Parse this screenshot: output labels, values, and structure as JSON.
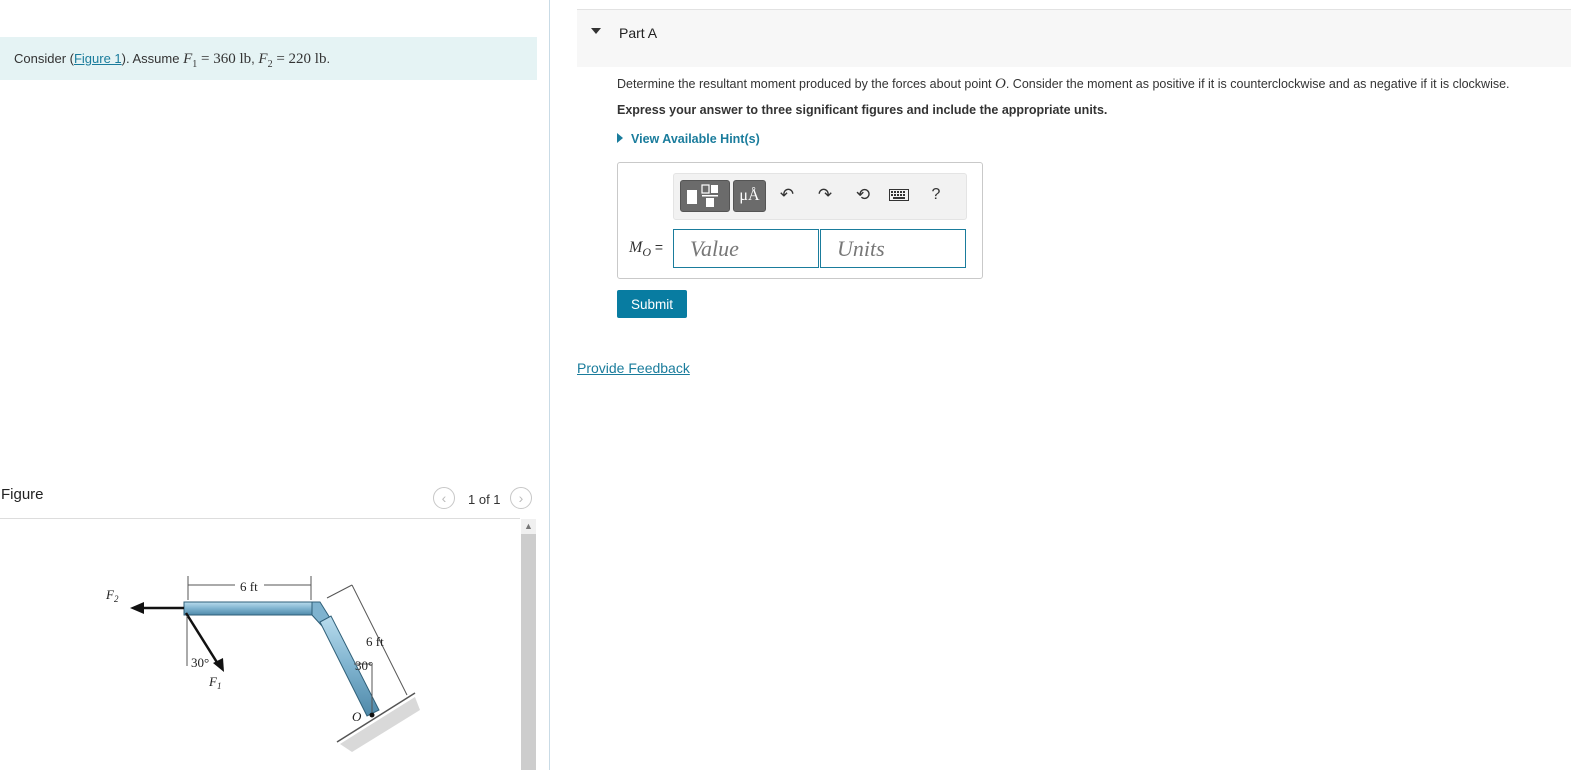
{
  "problem": {
    "prefix": "Consider (",
    "figure_link": "Figure 1",
    "suffix": "). Assume ",
    "f1_sym": "F",
    "f1_sub": "1",
    "f1_val": " = 360 lb",
    "sep": ", ",
    "f2_sym": "F",
    "f2_sub": "2",
    "f2_val": " = 220 lb",
    "end": "."
  },
  "figure": {
    "title": "Figure",
    "pager_text": "1 of 1",
    "prev_icon": "chevron-left-icon",
    "next_icon": "chevron-right-icon",
    "labels": {
      "f2": "F",
      "f2_sub": "2",
      "f1": "F",
      "f1_sub": "1",
      "dim_top": "6 ft",
      "dim_slant": "6 ft",
      "angle_left": "30°",
      "angle_right": "30°",
      "point_o": "O"
    }
  },
  "part": {
    "title": "Part A",
    "question_pre": "Determine the resultant moment produced by the forces about point ",
    "question_point": "O",
    "question_post": ". Consider the moment as positive if it is counterclockwise and as negative if it is clockwise.",
    "instruction": "Express your answer to three significant figures and include the appropriate units.",
    "hint_label": "View Available Hint(s)"
  },
  "toolbar": {
    "templates_icon": "templates-icon",
    "symbols_label": "μÅ",
    "undo_icon": "↶",
    "redo_icon": "↷",
    "reset_icon": "⟲",
    "keyboard_icon": "keyboard-icon",
    "help_label": "?"
  },
  "answer": {
    "label_sym": "M",
    "label_sub": "O",
    "label_eq": " =",
    "value_placeholder": "Value",
    "units_placeholder": "Units"
  },
  "submit_label": "Submit",
  "feedback_label": "Provide Feedback"
}
